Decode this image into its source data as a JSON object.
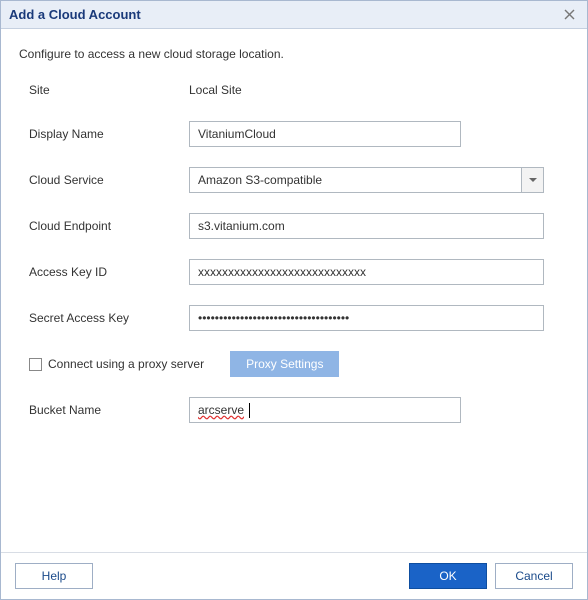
{
  "titlebar": {
    "title": "Add a Cloud Account"
  },
  "subtitle": "Configure to access a new cloud storage location.",
  "form": {
    "site": {
      "label": "Site",
      "value": "Local Site"
    },
    "display_name": {
      "label": "Display Name",
      "value": "VitaniumCloud"
    },
    "cloud_service": {
      "label": "Cloud Service",
      "value": "Amazon S3-compatible"
    },
    "cloud_endpoint": {
      "label": "Cloud Endpoint",
      "value": "s3.vitanium.com"
    },
    "access_key": {
      "label": "Access Key ID",
      "value": "xxxxxxxxxxxxxxxxxxxxxxxxxxxx"
    },
    "secret_key": {
      "label": "Secret Access Key",
      "value": "••••••••••••••••••••••••••••••••••••"
    },
    "proxy": {
      "checkbox_label": "Connect using a proxy server",
      "button_label": "Proxy Settings"
    },
    "bucket_name": {
      "label": "Bucket Name",
      "value": "arcserve"
    }
  },
  "footer": {
    "help": "Help",
    "ok": "OK",
    "cancel": "Cancel"
  }
}
